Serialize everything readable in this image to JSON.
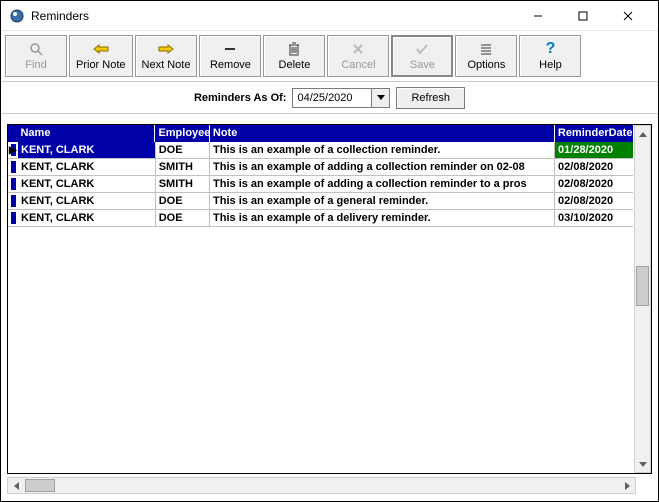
{
  "window": {
    "title": "Reminders"
  },
  "toolbar": {
    "find": "Find",
    "prior": "Prior Note",
    "next": "Next Note",
    "remove": "Remove",
    "delete": "Delete",
    "cancel": "Cancel",
    "save": "Save",
    "options": "Options",
    "help": "Help"
  },
  "filter": {
    "label": "Reminders As Of:",
    "date": "04/25/2020",
    "refresh": "Refresh"
  },
  "columns": {
    "name": "Name",
    "employee": "Employee",
    "note": "Note",
    "reminderDate": "ReminderDate"
  },
  "rows": [
    {
      "name": "KENT, CLARK",
      "employee": "DOE",
      "note": "This is an example of a collection reminder.",
      "date": "01/28/2020",
      "selected": true
    },
    {
      "name": "KENT, CLARK",
      "employee": "SMITH",
      "note": "This is an example of adding a collection reminder on 02-08",
      "date": "02/08/2020",
      "selected": false
    },
    {
      "name": "KENT, CLARK",
      "employee": "SMITH",
      "note": "This is an example of adding a collection reminder to a pros",
      "date": "02/08/2020",
      "selected": false
    },
    {
      "name": "KENT, CLARK",
      "employee": "DOE",
      "note": "This is an example of a general reminder.",
      "date": "02/08/2020",
      "selected": false
    },
    {
      "name": "KENT, CLARK",
      "employee": "DOE",
      "note": "This is an example of a delivery reminder.",
      "date": "03/10/2020",
      "selected": false
    }
  ]
}
